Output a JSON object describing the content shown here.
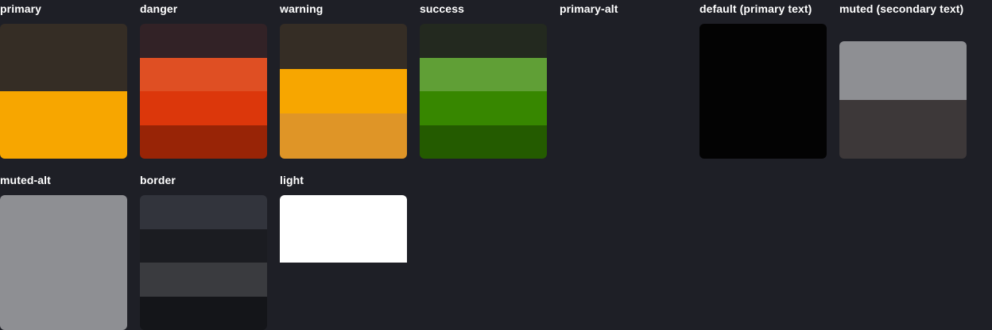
{
  "groups": {
    "primary": {
      "label": "primary",
      "colors": [
        "#352d25",
        "#f7a600"
      ]
    },
    "danger": {
      "label": "danger",
      "colors": [
        "#322226",
        "#df4f23",
        "#dc370b",
        "#982406"
      ]
    },
    "warning": {
      "label": "warning",
      "colors": [
        "#352d25",
        "#f7a600",
        "#df9527"
      ]
    },
    "success": {
      "label": "success",
      "colors": [
        "#23291f",
        "#609f36",
        "#378700",
        "#245b00"
      ]
    },
    "primary_alt": {
      "label": "primary-alt",
      "colors": []
    },
    "default": {
      "label": "default (primary text)",
      "colors": [
        "#030303"
      ]
    },
    "muted": {
      "label": "muted (secondary text)",
      "colors": [
        "#8e8f93",
        "#3d3839"
      ]
    },
    "muted_alt": {
      "label": "muted-alt",
      "colors": [
        "#8e8f93"
      ]
    },
    "border": {
      "label": "border",
      "colors": [
        "#32343c",
        "#1b1c21",
        "#3a3b3f",
        "#141519"
      ]
    },
    "light": {
      "label": "light",
      "colors": [
        "#ffffff"
      ]
    }
  },
  "page_background": "#1e1f26"
}
